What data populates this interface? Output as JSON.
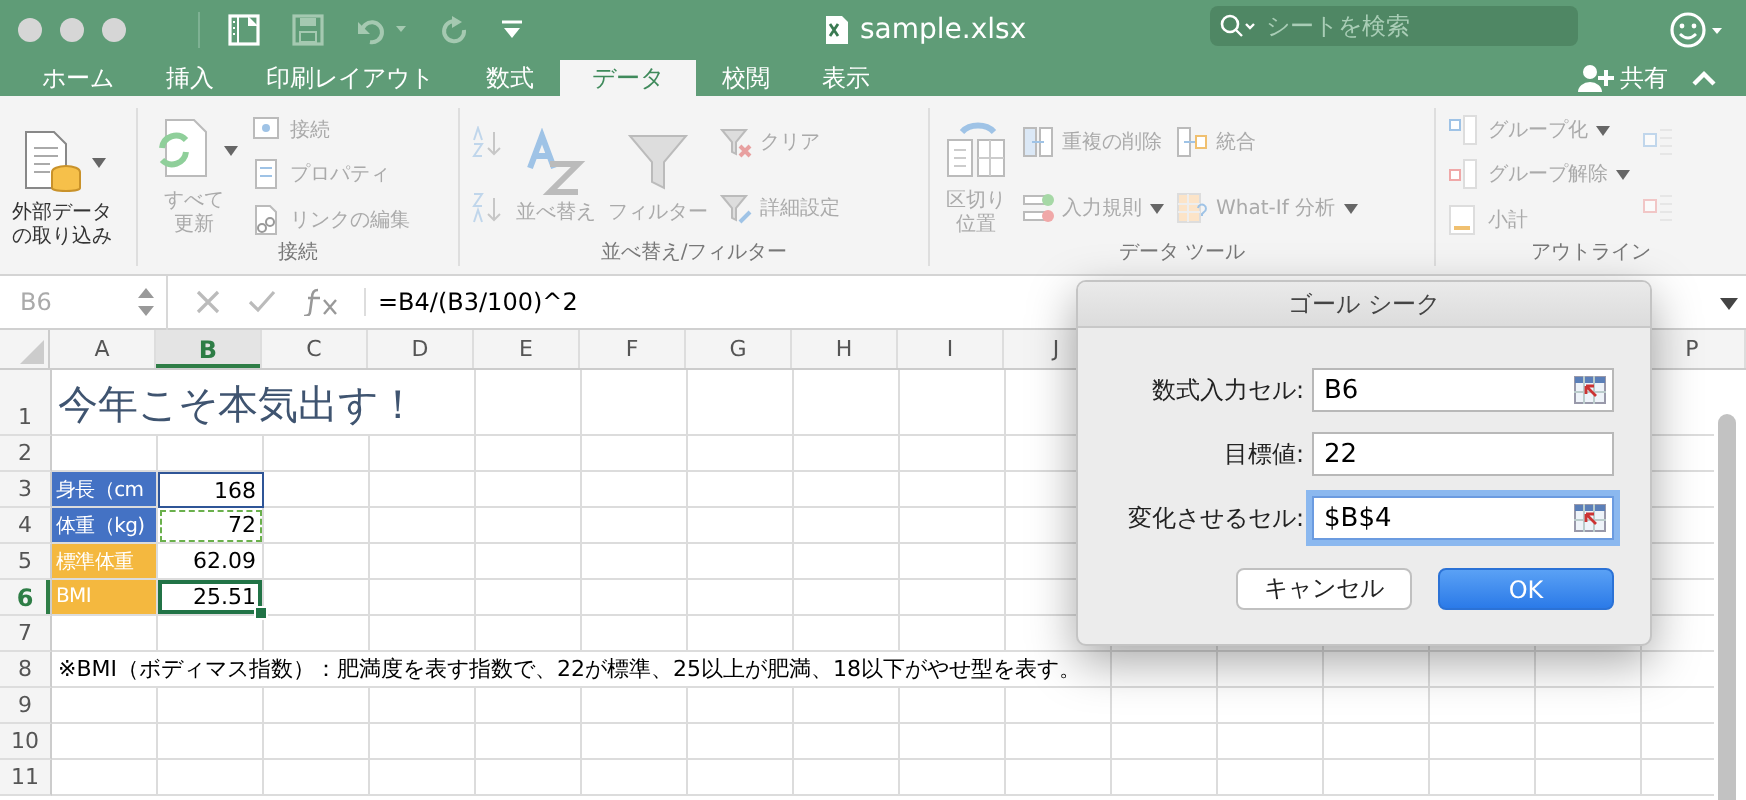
{
  "window": {
    "title": "sample.xlsx",
    "search": {
      "placeholder": "シートを検索"
    }
  },
  "tabs": [
    {
      "label": "ホーム",
      "selected": false
    },
    {
      "label": "挿入",
      "selected": false
    },
    {
      "label": "印刷レイアウト",
      "selected": false
    },
    {
      "label": "数式",
      "selected": false
    },
    {
      "label": "データ",
      "selected": true
    },
    {
      "label": "校閲",
      "selected": false
    },
    {
      "label": "表示",
      "selected": false
    }
  ],
  "share": {
    "label": "共有"
  },
  "ribbon": {
    "groups": [
      {
        "items": [
          {
            "kind": "large",
            "label": "外部データの取り込み",
            "disabled": false,
            "dropdown": true
          }
        ]
      },
      {
        "label": "接続",
        "items": [
          {
            "kind": "large",
            "label": "すべて更新",
            "disabled": true,
            "dropdown": true
          },
          {
            "kind": "small",
            "label": "接続",
            "disabled": true,
            "dropdown": false
          },
          {
            "kind": "small",
            "label": "プロパティ",
            "disabled": true,
            "dropdown": false
          },
          {
            "kind": "small",
            "label": "リンクの編集",
            "disabled": true,
            "dropdown": false
          }
        ]
      },
      {
        "label": "並べ替え/フィルター",
        "items": [
          {
            "kind": "icon",
            "disabled": true
          },
          {
            "kind": "icon",
            "disabled": true
          },
          {
            "kind": "large",
            "label": "並べ替え",
            "disabled": true,
            "dropdown": false
          },
          {
            "kind": "large",
            "label": "フィルター",
            "disabled": true,
            "dropdown": false
          },
          {
            "kind": "small",
            "label": "クリア",
            "disabled": true,
            "dropdown": false
          },
          {
            "kind": "small",
            "label": "詳細設定",
            "disabled": true,
            "dropdown": false
          }
        ]
      },
      {
        "label": "データ ツール",
        "items": [
          {
            "kind": "large",
            "label": "区切り位置",
            "disabled": true,
            "dropdown": false
          },
          {
            "kind": "small",
            "label": "重複の削除",
            "disabled": true,
            "dropdown": false
          },
          {
            "kind": "small",
            "label": "入力規則",
            "disabled": true,
            "dropdown": true
          },
          {
            "kind": "small",
            "label": "統合",
            "disabled": true,
            "dropdown": false
          },
          {
            "kind": "small",
            "label": "What-If 分析",
            "disabled": true,
            "dropdown": true
          }
        ]
      },
      {
        "label": "アウトライン",
        "items": [
          {
            "kind": "small",
            "label": "グループ化",
            "disabled": true,
            "dropdown": true
          },
          {
            "kind": "small",
            "label": "グループ解除",
            "disabled": true,
            "dropdown": true
          },
          {
            "kind": "small",
            "label": "小計",
            "disabled": true,
            "dropdown": false
          },
          {
            "kind": "icon",
            "disabled": true
          },
          {
            "kind": "icon",
            "disabled": true
          }
        ]
      }
    ]
  },
  "formula_bar": {
    "name_box": "B6",
    "formula": "=B4/(B3/100)^2"
  },
  "sheet": {
    "columns": [
      {
        "label": "A",
        "selected": false
      },
      {
        "label": "B",
        "selected": true
      },
      {
        "label": "C",
        "selected": false
      },
      {
        "label": "D",
        "selected": false
      },
      {
        "label": "E",
        "selected": false
      },
      {
        "label": "F",
        "selected": false
      },
      {
        "label": "G",
        "selected": false
      },
      {
        "label": "H",
        "selected": false
      },
      {
        "label": "I",
        "selected": false
      },
      {
        "label": "J",
        "selected": false
      },
      {
        "label": "P",
        "selected": false
      }
    ],
    "rows": [
      {
        "number": "1",
        "selected": false,
        "kind": "title",
        "text": "今年こそ本気出す！"
      },
      {
        "number": "2",
        "selected": false,
        "kind": "empty"
      },
      {
        "number": "3",
        "selected": false,
        "kind": "cells",
        "cells": [
          {
            "kind": "label",
            "text": "身長（cm",
            "color": "#4472c4",
            "selected": false
          },
          {
            "kind": "number",
            "text": "168",
            "selected": false,
            "highlighted": true,
            "dashed": false
          }
        ]
      },
      {
        "number": "4",
        "selected": false,
        "kind": "cells",
        "cells": [
          {
            "kind": "label",
            "text": "体重（kg)",
            "color": "#4472c4",
            "selected": false
          },
          {
            "kind": "number",
            "text": "72",
            "selected": false,
            "highlighted": false,
            "dashed": true
          }
        ]
      },
      {
        "number": "5",
        "selected": false,
        "kind": "cells",
        "cells": [
          {
            "kind": "label",
            "text": "標準体重",
            "color": "#f4b83f",
            "selected": false
          },
          {
            "kind": "number",
            "text": "62.09",
            "selected": false,
            "highlighted": false,
            "dashed": false
          }
        ]
      },
      {
        "number": "6",
        "selected": true,
        "kind": "cells",
        "cells": [
          {
            "kind": "label",
            "text": "BMI",
            "color": "#f4b83f",
            "selected": false
          },
          {
            "kind": "number",
            "text": "25.51",
            "selected": true,
            "highlighted": false,
            "dashed": false
          }
        ]
      },
      {
        "number": "7",
        "selected": false,
        "kind": "empty"
      },
      {
        "number": "8",
        "selected": false,
        "kind": "note",
        "text": "※BMI（ボディマス指数）：肥満度を表す指数で、22が標準、25以上が肥満、18以下がやせ型を表す。"
      },
      {
        "number": "9",
        "selected": false,
        "kind": "empty"
      },
      {
        "number": "10",
        "selected": false,
        "kind": "empty"
      },
      {
        "number": "11",
        "selected": false,
        "kind": "empty"
      }
    ]
  },
  "dialog": {
    "title": "ゴール シーク",
    "fields": [
      {
        "label": "数式入力セル:",
        "value": "B6",
        "picker": true,
        "focused": false
      },
      {
        "label": "目標値:",
        "value": "22",
        "picker": false,
        "focused": false
      },
      {
        "label": "変化させるセル:",
        "value": "$B$4",
        "picker": true,
        "focused": true
      }
    ],
    "buttons": [
      {
        "label": "キャンセル",
        "default": false
      },
      {
        "label": "OK",
        "default": true
      }
    ]
  }
}
